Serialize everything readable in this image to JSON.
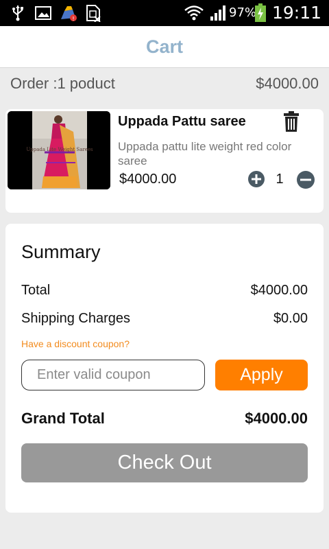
{
  "status_bar": {
    "icons": [
      "usb-icon",
      "gallery-icon",
      "cleaner-app-icon",
      "sim-card-icon",
      "wifi-icon",
      "signal-icon",
      "battery-charging-icon"
    ],
    "battery_percent": "97%",
    "time": "19:11"
  },
  "app_bar": {
    "title": "Cart"
  },
  "order": {
    "label": "Order :1 poduct",
    "total": "$4000.00"
  },
  "cart_items": [
    {
      "name": "Uppada Pattu saree",
      "description": "Uppada pattu lite weight red color saree",
      "price": "$4000.00",
      "quantity": "1",
      "image_caption": "Uppada Lite Weight Sarees"
    }
  ],
  "summary": {
    "title": "Summary",
    "total_label": "Total",
    "total_value": "$4000.00",
    "shipping_label": "Shipping Charges",
    "shipping_value": "$0.00",
    "coupon_link": "Have a discount coupon?",
    "coupon_placeholder": "Enter valid coupon",
    "coupon_value": "",
    "apply_label": "Apply",
    "grand_total_label": "Grand Total",
    "grand_total_value": "$4000.00",
    "checkout_label": "Check Out"
  },
  "colors": {
    "title_blue": "#93b3cc",
    "accent_orange": "#ff7f00",
    "link_orange": "#f28b1e",
    "checkout_gray": "#999999",
    "background": "#ececec"
  }
}
